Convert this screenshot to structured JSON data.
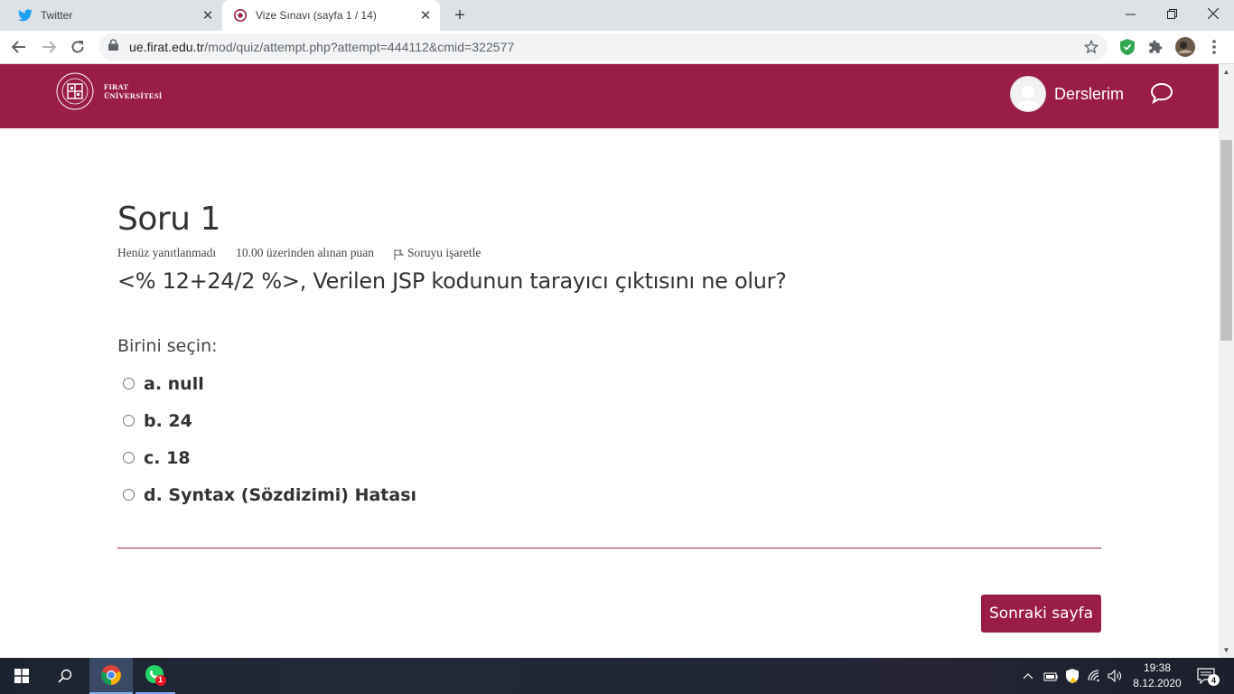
{
  "browser": {
    "tabs": [
      {
        "title": "Twitter",
        "favicon": "twitter-icon",
        "active": false
      },
      {
        "title": "Vize Sınavı (sayfa 1 / 14)",
        "favicon": "moodle-icon",
        "active": true
      }
    ],
    "url_host": "ue.firat.edu.tr",
    "url_path": "/mod/quiz/attempt.php?attempt=444112&cmid=322577"
  },
  "header": {
    "logo_line1": "FIRAT",
    "logo_line2": "ÜNİVERSİTESİ",
    "user_menu_label": "Derslerim",
    "brand_color": "#991d47"
  },
  "question": {
    "title": "Soru 1",
    "status": "Henüz yanıtlanmadı",
    "grade": "10.00 üzerinden alınan puan",
    "flag_label": "Soruyu işaretle",
    "text": "<% 12+24/2 %>, Verilen JSP kodunun tarayıcı çıktısını ne olur?",
    "prompt": "Birini seçin:",
    "options": [
      {
        "label": "a. null"
      },
      {
        "label": "b. 24"
      },
      {
        "label": "c. 18"
      },
      {
        "label": "d. Syntax (Sözdizimi) Hatası"
      }
    ]
  },
  "navigation": {
    "next_label": "Sonraki sayfa"
  },
  "taskbar": {
    "time": "19:38",
    "date": "8.12.2020",
    "notification_count": "4",
    "whatsapp_badge": "1"
  }
}
